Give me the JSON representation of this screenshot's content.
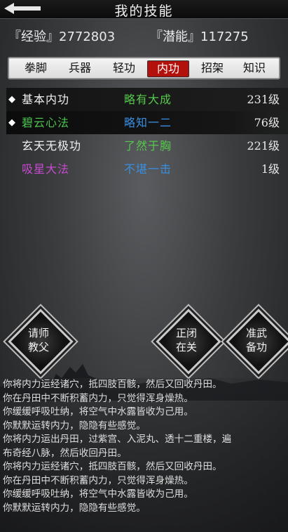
{
  "header": {
    "title": "我的技能",
    "back_icon": "back-arrow-icon"
  },
  "stats": {
    "exp_label": "『经验』2772803",
    "potential_label": "『潜能』117275"
  },
  "tabs": [
    {
      "label": "拳脚",
      "active": false
    },
    {
      "label": "兵器",
      "active": false
    },
    {
      "label": "轻功",
      "active": false
    },
    {
      "label": "内功",
      "active": true
    },
    {
      "label": "招架",
      "active": false
    },
    {
      "label": "知识",
      "active": false
    }
  ],
  "skills": [
    {
      "marker": "◆",
      "name": "基本内功",
      "level": "略有大成",
      "grade": "231级",
      "name_color": "#f2f2f2",
      "level_color": "#56c84c"
    },
    {
      "marker": "◆",
      "name": "碧云心法",
      "level": "略知一二",
      "grade": "76级",
      "name_color": "#4ac44e",
      "level_color": "#3a8ee0"
    },
    {
      "marker": "",
      "name": "玄天无极功",
      "level": "了然于胸",
      "grade": "221级",
      "name_color": "#f2f2f2",
      "level_color": "#56c84c"
    },
    {
      "marker": "",
      "name": "吸星大法",
      "level": "不堪一击",
      "grade": "1级",
      "name_color": "#c84ad0",
      "level_color": "#3a8ee0"
    }
  ],
  "actions": {
    "teacher": "请师\n教父",
    "close": "正闭\n在关",
    "prepare": "准武\n备功"
  },
  "log": [
    "你将内力运经诸穴，抵四肢百骸，然后又回收丹田。",
    "你在丹田中不断积蓄内力，只觉得浑身燥热。",
    "你缓缓呼吸吐纳，将空气中水露皆收为己用。",
    "你默默运转内力，隐隐有些感觉。",
    "你将内力运出丹田，过紫宫、入泥丸、透十二重楼，遍",
    "布奇经八脉，然后收回丹田。",
    "你将内力运经诸穴，抵四肢百骸，然后又回收丹田。",
    "你在丹田中不断积蓄内力，只觉得浑身燥热。",
    "你缓缓呼吸吐纳，将空气中水露皆收为己用。",
    "你默默运转内力，隐隐有些感觉。"
  ]
}
